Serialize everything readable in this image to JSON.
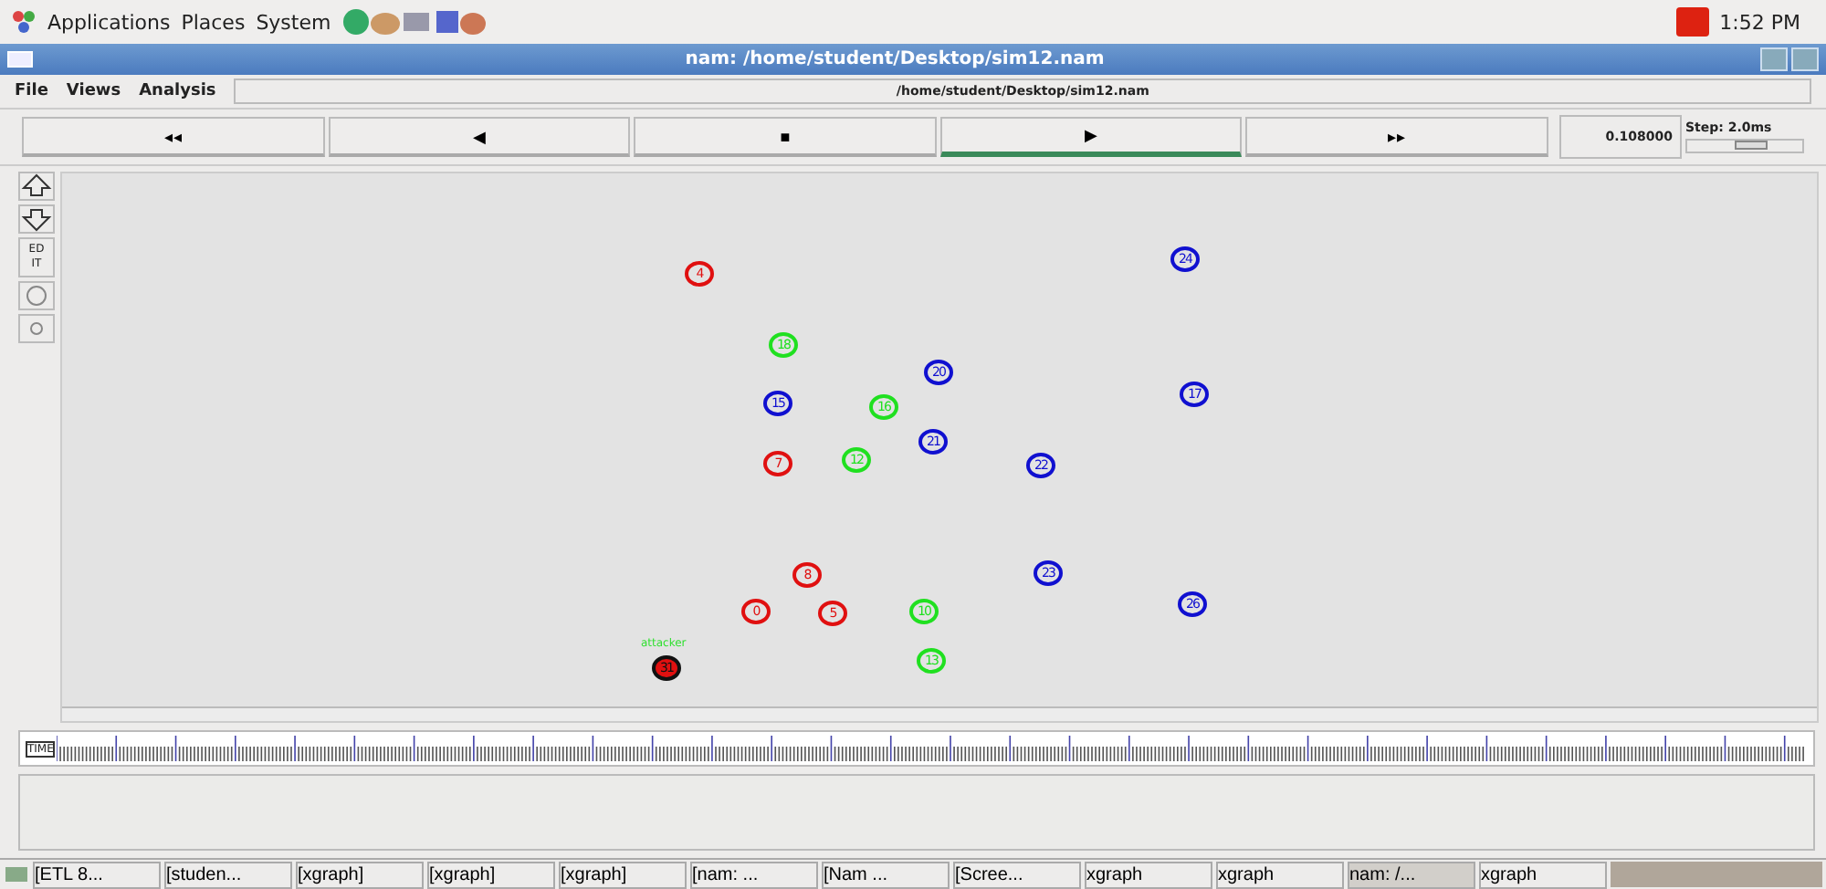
{
  "top_panel": {
    "menus": [
      "Applications",
      "Places",
      "System"
    ],
    "clock": "1:52 PM"
  },
  "window": {
    "title": "nam: /home/student/Desktop/sim12.nam"
  },
  "menu_bar": {
    "items": [
      "File",
      "Views",
      "Analysis"
    ],
    "file_path": "/home/student/Desktop/sim12.nam"
  },
  "controls": [
    {
      "symbol": "◂◂",
      "selected": false
    },
    {
      "symbol": "◀",
      "selected": false
    },
    {
      "symbol": "■",
      "selected": false
    },
    {
      "symbol": "▶",
      "selected": true
    },
    {
      "symbol": "▸▸",
      "selected": false
    }
  ],
  "time": "0.108000",
  "step": {
    "label": "Step: 2.0ms",
    "level": 0.55
  },
  "edit_tool": "ED IT",
  "nodes": [
    {
      "label": "4",
      "color": "#e01010"
    },
    {
      "label": "24",
      "color": "#1010d0"
    },
    {
      "label": "18",
      "color": "#20e020"
    },
    {
      "label": "20",
      "color": "#1010d0"
    },
    {
      "label": "15",
      "color": "#1010d0"
    },
    {
      "label": "16",
      "color": "#20e020"
    },
    {
      "label": "17",
      "color": "#1010d0"
    },
    {
      "label": "21",
      "color": "#1010d0"
    },
    {
      "label": "7",
      "color": "#e01010"
    },
    {
      "label": "12",
      "color": "#20e020"
    },
    {
      "label": "22",
      "color": "#1010d0"
    },
    {
      "label": "8",
      "color": "#e01010"
    },
    {
      "label": "23",
      "color": "#1010d0"
    },
    {
      "label": "0",
      "color": "#e01010"
    },
    {
      "label": "5",
      "color": "#e01010"
    },
    {
      "label": "10",
      "color": "#20e020"
    },
    {
      "label": "26",
      "color": "#1010d0"
    },
    {
      "label": "13",
      "color": "#20e020"
    },
    {
      "label": "31",
      "color": "#e01010",
      "caption": "attacker"
    }
  ],
  "timeline": {
    "label": "TIME"
  },
  "taskbar": [
    {
      "label": "[ETL 8...",
      "selected": false
    },
    {
      "label": "[studen...",
      "selected": false
    },
    {
      "label": "[xgraph]",
      "selected": false
    },
    {
      "label": "[xgraph]",
      "selected": false
    },
    {
      "label": "[xgraph]",
      "selected": false
    },
    {
      "label": "[nam: ...",
      "selected": false
    },
    {
      "label": "[Nam ...",
      "selected": false
    },
    {
      "label": "[Scree...",
      "selected": false
    },
    {
      "label": "xgraph",
      "selected": false
    },
    {
      "label": "xgraph",
      "selected": false
    },
    {
      "label": "nam: /...",
      "selected": true
    },
    {
      "label": "xgraph",
      "selected": false
    }
  ]
}
